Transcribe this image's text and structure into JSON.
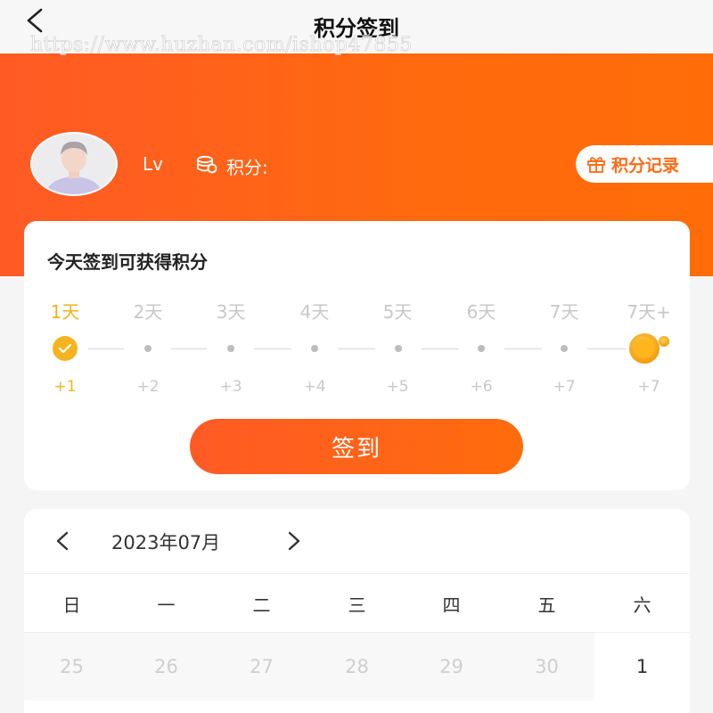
{
  "nav": {
    "title": "积分签到",
    "back_icon": "chevron-left-icon"
  },
  "watermark": "https://www.huzhan.com/ishop47855",
  "profile": {
    "level_label": "Lv",
    "points_label": "积分:",
    "coin_icon": "coins-icon",
    "record_button": "积分记录",
    "record_icon": "gift-icon"
  },
  "signin": {
    "heading": "今天签到可获得积分",
    "days": [
      "1天",
      "2天",
      "3天",
      "4天",
      "5天",
      "6天",
      "7天",
      "7天+"
    ],
    "points": [
      "+1",
      "+2",
      "+3",
      "+4",
      "+5",
      "+6",
      "+7",
      "+7"
    ],
    "button_label": "签到",
    "accent_color": "#f2b21c",
    "brand_color": "#ff6a14"
  },
  "calendar": {
    "month_label": "2023年07月",
    "weekdays": [
      "日",
      "一",
      "二",
      "三",
      "四",
      "五",
      "六"
    ],
    "dates": [
      "25",
      "26",
      "27",
      "28",
      "29",
      "30",
      "1"
    ]
  }
}
